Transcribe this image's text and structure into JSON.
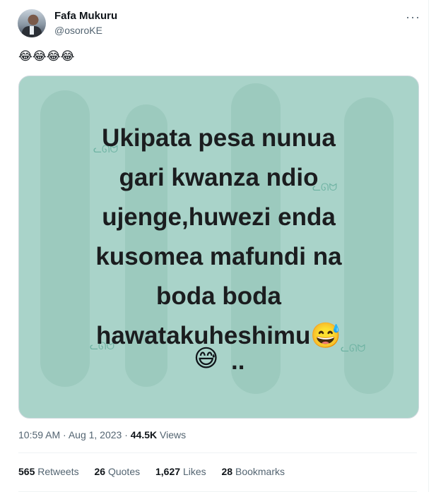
{
  "author": {
    "name": "Fafa Mukuru",
    "handle": "@osoroKE"
  },
  "menu": {
    "more_label": "···"
  },
  "tweet": {
    "text": "😂😂😂😂"
  },
  "media": {
    "lines": [
      "Ukipata pesa nunua",
      "gari kwanza ndio",
      "ujenge,huwezi enda",
      "kusomea mafundi na",
      "boda boda",
      "hawatakuheshimu😅"
    ],
    "last_emoji": "😅",
    "last_suffix": ".."
  },
  "meta": {
    "time": "10:59 AM · Aug 1, 2023 · ",
    "views_count": "44.5K",
    "views_label": " Views"
  },
  "stats": {
    "retweets_count": "565",
    "retweets_label": "Retweets",
    "quotes_count": "26",
    "quotes_label": "Quotes",
    "likes_count": "1,627",
    "likes_label": "Likes",
    "bookmarks_count": "28",
    "bookmarks_label": "Bookmarks"
  },
  "colors": {
    "accent_text": "#0f1419",
    "secondary_text": "#536471",
    "media_bg": "#a9d3c9"
  }
}
